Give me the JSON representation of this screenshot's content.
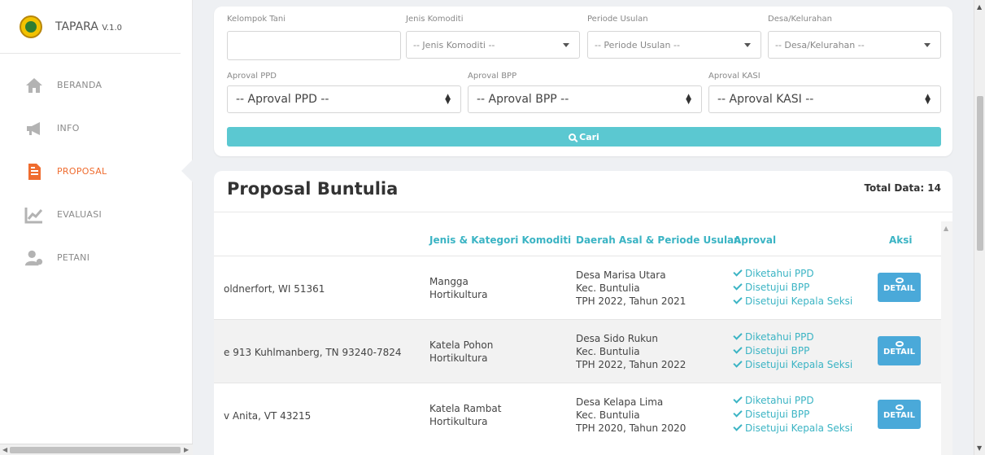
{
  "brand": {
    "title": "TAPARA",
    "version": "V.1.0"
  },
  "nav": [
    {
      "label": "BERANDA",
      "icon": "home-icon"
    },
    {
      "label": "INFO",
      "icon": "megaphone-icon"
    },
    {
      "label": "PROPOSAL",
      "icon": "document-icon",
      "active": true
    },
    {
      "label": "EVALUASI",
      "icon": "chart-icon"
    },
    {
      "label": "PETANI",
      "icon": "user-icon"
    }
  ],
  "filters": {
    "kelompok_label": "Kelompok Tani",
    "kelompok_value": "",
    "jenis_label": "Jenis Komoditi",
    "jenis_value": "-- Jenis Komoditi --",
    "periode_label": "Periode Usulan",
    "periode_value": "-- Periode Usulan --",
    "desa_label": "Desa/Kelurahan",
    "desa_value": "-- Desa/Kelurahan --",
    "ppd_label": "Aproval PPD",
    "ppd_value": "-- Aproval PPD --",
    "bpp_label": "Aproval BPP",
    "bpp_value": "-- Aproval BPP --",
    "kasi_label": "Aproval KASI",
    "kasi_value": "-- Aproval KASI --",
    "search_label": "Cari"
  },
  "table": {
    "title": "Proposal Buntulia",
    "total": "Total Data: 14",
    "headers": [
      "Jenis & Kategori Komoditi",
      "Daerah Asal & Periode Usulan",
      "Aproval",
      "Aksi"
    ],
    "detail_label": "DETAIL",
    "rows": [
      {
        "address": "oldnerfort, WI 51361",
        "komoditi": "Mangga",
        "kategori": "Hortikultura",
        "desa": "Desa Marisa Utara",
        "kec": "Kec. Buntulia",
        "periode": "TPH 2022, Tahun 2021",
        "ap1": "Diketahui PPD",
        "ap2": "Disetujui BPP",
        "ap3": "Disetujui Kepala Seksi"
      },
      {
        "address": "e 913 Kuhlmanberg, TN 93240-7824",
        "komoditi": "Katela Pohon",
        "kategori": "Hortikultura",
        "desa": "Desa Sido Rukun",
        "kec": "Kec. Buntulia",
        "periode": "TPH 2022, Tahun 2022",
        "ap1": "Diketahui PPD",
        "ap2": "Disetujui BPP",
        "ap3": "Disetujui Kepala Seksi"
      },
      {
        "address": "v Anita, VT 43215",
        "komoditi": "Katela Rambat",
        "kategori": "Hortikultura",
        "desa": "Desa Kelapa Lima",
        "kec": "Kec. Buntulia",
        "periode": "TPH 2020, Tahun 2020",
        "ap1": "Diketahui PPD",
        "ap2": "Disetujui BPP",
        "ap3": "Disetujui Kepala Seksi"
      }
    ]
  },
  "colors": {
    "accent": "#5bc8d1",
    "active_nav": "#ef6c2f",
    "detail_button": "#4aa9d9",
    "approval_text": "#3bb4c4"
  }
}
